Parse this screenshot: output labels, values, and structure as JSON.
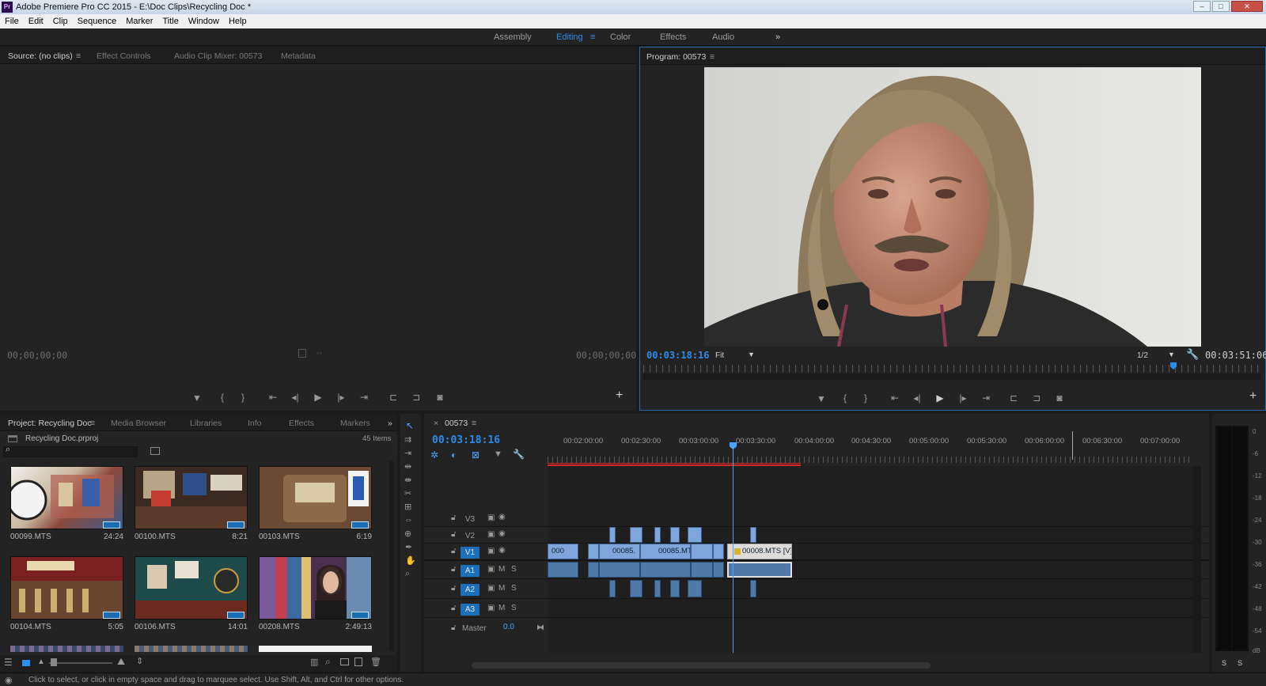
{
  "window": {
    "title": "Adobe Premiere Pro CC 2015 - E:\\Doc Clips\\Recycling Doc *",
    "app_icon": "Pr"
  },
  "menu": [
    "File",
    "Edit",
    "Clip",
    "Sequence",
    "Marker",
    "Title",
    "Window",
    "Help"
  ],
  "workspaces": {
    "items": [
      "Assembly",
      "Editing",
      "Color",
      "Effects",
      "Audio"
    ],
    "active": "Editing",
    "more": "»"
  },
  "source_panel": {
    "tabs": [
      "Source: (no clips)",
      "Effect Controls",
      "Audio Clip Mixer: 00573",
      "Metadata"
    ],
    "timecode_in": "00;00;00;00",
    "timecode_out": "00;00;00;00",
    "add": "+"
  },
  "program_panel": {
    "tab": "Program: 00573",
    "timecode_current": "00:03:18:16",
    "fit_label": "Fit",
    "resolution": "1/2",
    "timecode_duration": "00:03:51:06",
    "add": "+"
  },
  "project_panel": {
    "tabs": [
      "Project: Recycling Doc",
      "Media Browser",
      "Libraries",
      "Info",
      "Effects",
      "Markers"
    ],
    "file_name": "Recycling Doc.prproj",
    "item_count": "45 Items",
    "more": "»",
    "clips": [
      {
        "name": "00099.MTS",
        "duration": "24:24"
      },
      {
        "name": "00100.MTS",
        "duration": "8:21"
      },
      {
        "name": "00103.MTS",
        "duration": "6:19"
      },
      {
        "name": "00104.MTS",
        "duration": "5:05"
      },
      {
        "name": "00106.MTS",
        "duration": "14:01"
      },
      {
        "name": "00208.MTS",
        "duration": "2:49:13"
      }
    ]
  },
  "timeline": {
    "close": "×",
    "sequence_name": "00573",
    "timecode": "00:03:18:16",
    "ruler_labels": [
      "00:02:00:00",
      "00:02:30:00",
      "00:03:00:00",
      "00:03:30:00",
      "00:04:00:00",
      "00:04:30:00",
      "00:05:00:00",
      "00:05:30:00",
      "00:06:00:00",
      "00:06:30:00",
      "00:07:00:00"
    ],
    "video_tracks": [
      "V3",
      "V2",
      "V1"
    ],
    "audio_tracks": [
      "A1",
      "A2",
      "A3"
    ],
    "source_v": "V1",
    "source_a": "A1",
    "master_label": "Master",
    "master_value": "0.0",
    "mute": "M",
    "solo": "S",
    "v1_clips": [
      "000",
      "00085.",
      "00085.MT",
      "00008.MTS [V]"
    ]
  },
  "meter": {
    "labels": [
      "0",
      "-6",
      "-12",
      "-18",
      "-24",
      "-30",
      "-36",
      "-42",
      "-48",
      "-54",
      "dB"
    ],
    "solo_left": "S",
    "solo_right": "S"
  },
  "status_bar": {
    "message": "Click to select, or click in empty space and drag to marquee select. Use Shift, Alt, and Ctrl for other options."
  },
  "colors": {
    "accent": "#2d8ceb",
    "clip_video": "#7fa6db",
    "clip_audio": "#4f7aa8",
    "render_bar": "#d42a2a"
  }
}
